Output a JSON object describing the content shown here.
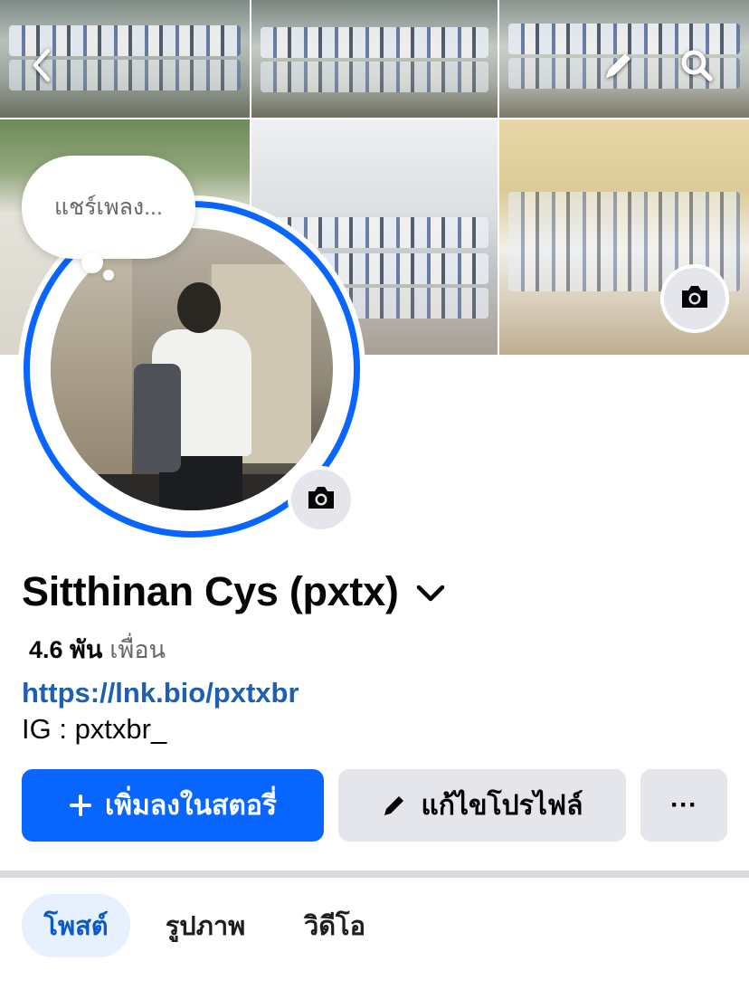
{
  "cover": {
    "back_icon": "chevron-left-icon",
    "edit_icon": "pencil-icon",
    "search_icon": "search-icon",
    "camera_icon": "camera-icon"
  },
  "note": {
    "text": "แชร์เพลง..."
  },
  "profile": {
    "name": "Sitthinan Cys (pxtx)",
    "friends_count": "4.6 พัน",
    "friends_label": "เพื่อน",
    "link": "https://lnk.bio/pxtxbr",
    "bio": "IG : pxtxbr_"
  },
  "actions": {
    "add_story_label": "เพิ่มลงในสตอรี่",
    "edit_profile_label": "แก้ไขโปรไฟล์",
    "more_label": "···"
  },
  "tabs": [
    {
      "label": "โพสต์",
      "active": true
    },
    {
      "label": "รูปภาพ",
      "active": false
    },
    {
      "label": "วิดีโอ",
      "active": false
    }
  ],
  "colors": {
    "accent": "#0866ff",
    "link": "#1e5fb0",
    "secondary_button": "#e4e6eb",
    "active_tab_bg": "#e7f0fd",
    "active_tab_text": "#0a58ca"
  }
}
